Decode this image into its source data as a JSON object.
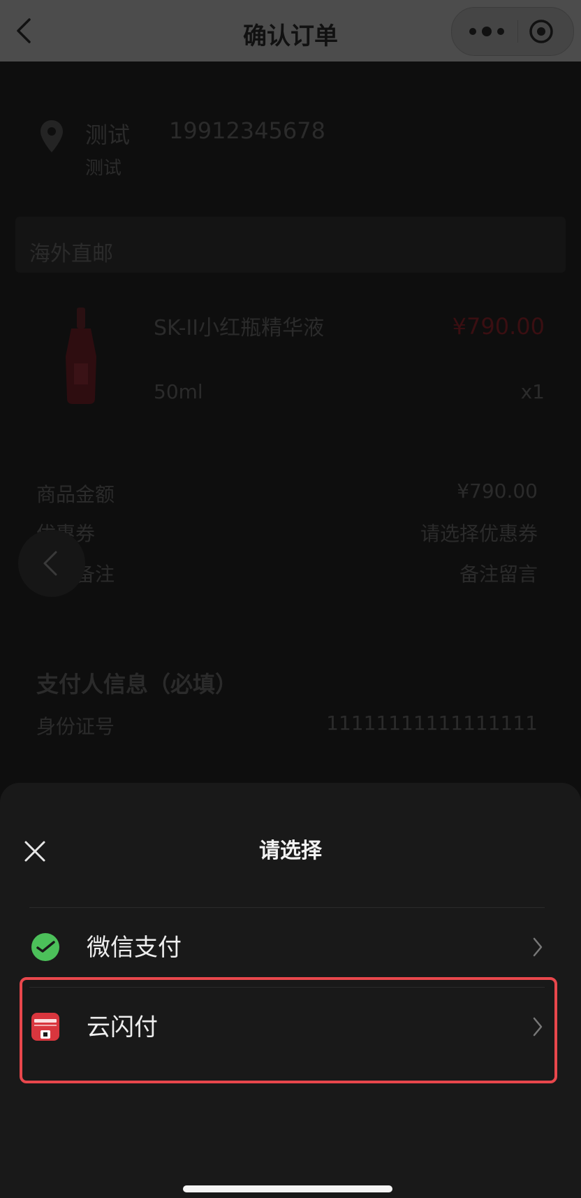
{
  "navbar": {
    "title": "确认订单",
    "back_icon": "chevron-left-icon",
    "more_icon": "more-dots-icon",
    "target_icon": "target-circle-icon"
  },
  "address": {
    "name": "测试",
    "phone": "19912345678",
    "detail": "测试",
    "icon": "location-pin-icon"
  },
  "shipping": {
    "label": "海外直邮"
  },
  "product": {
    "name": "SK-II小红瓶精华液",
    "price": "¥790.00",
    "spec": "50ml",
    "quantity": "x1"
  },
  "summary": {
    "rows": [
      {
        "label": "商品金额",
        "value": "¥790.00"
      },
      {
        "label": "优惠券",
        "value": "请选择优惠券"
      },
      {
        "label": "留言备注",
        "value": "备注留言"
      }
    ]
  },
  "payer": {
    "title": "支付人信息（必填）",
    "id_label": "身份证号",
    "id_value": "11111111111111111"
  },
  "sheet": {
    "title": "请选择",
    "close_icon": "close-icon",
    "options": [
      {
        "label": "微信支付",
        "icon": "wechat-pay-icon"
      },
      {
        "label": "云闪付",
        "icon": "unionpay-quickpass-icon"
      }
    ]
  },
  "colors": {
    "highlight": "#e8474c",
    "wechat_green": "#4cc05a",
    "unionpay_red": "#d9363e"
  }
}
